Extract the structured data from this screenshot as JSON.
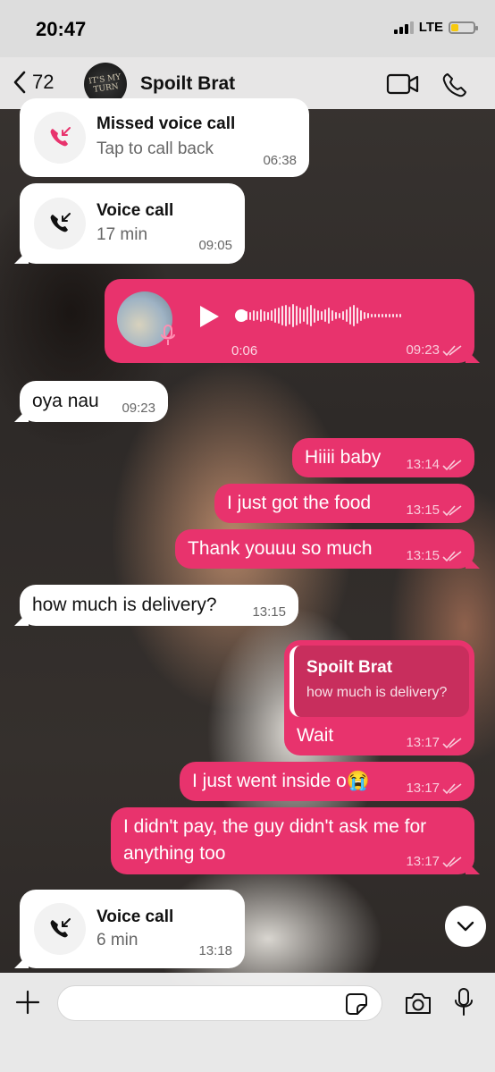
{
  "status_bar": {
    "time": "20:47",
    "network": "LTE"
  },
  "header": {
    "back_count": "72",
    "contact_name": "Spoilt Brat",
    "avatar_text": "IT'S MY TURN"
  },
  "messages": {
    "missed_call": {
      "title": "Missed voice call",
      "subtitle": "Tap to call back",
      "time": "06:38"
    },
    "call1": {
      "title": "Voice call",
      "subtitle": "17 min",
      "time": "09:05"
    },
    "voice_note": {
      "duration": "0:06",
      "time": "09:23"
    },
    "m1": {
      "text": "oya nau",
      "time": "09:23"
    },
    "m2": {
      "text": "Hiiii baby",
      "time": "13:14"
    },
    "m3": {
      "text": "I just got the food",
      "time": "13:15"
    },
    "m4": {
      "text": "Thank youuu so much",
      "time": "13:15"
    },
    "m5": {
      "text": "how much is delivery?",
      "time": "13:15"
    },
    "reply": {
      "quote_name": "Spoilt Brat",
      "quote_text": "how much is delivery?",
      "text": "Wait",
      "time": "13:17"
    },
    "m7": {
      "text": "I just went inside o😭",
      "time": "13:17"
    },
    "m8": {
      "text": "I didn't pay, the guy didn't ask me for anything too",
      "time": "13:17"
    },
    "call2": {
      "title": "Voice call",
      "subtitle": "6 min",
      "time": "13:18"
    }
  },
  "composer": {
    "placeholder": ""
  },
  "colors": {
    "outgoing": "#e8336d",
    "incoming": "#ffffff",
    "missed": "#e8336d"
  },
  "icons": [
    "back-chevron-icon",
    "video-call-icon",
    "phone-icon",
    "missed-call-icon",
    "incoming-call-icon",
    "play-icon",
    "mic-icon",
    "double-check-icon",
    "chevron-down-icon",
    "plus-icon",
    "sticker-icon",
    "camera-icon"
  ]
}
